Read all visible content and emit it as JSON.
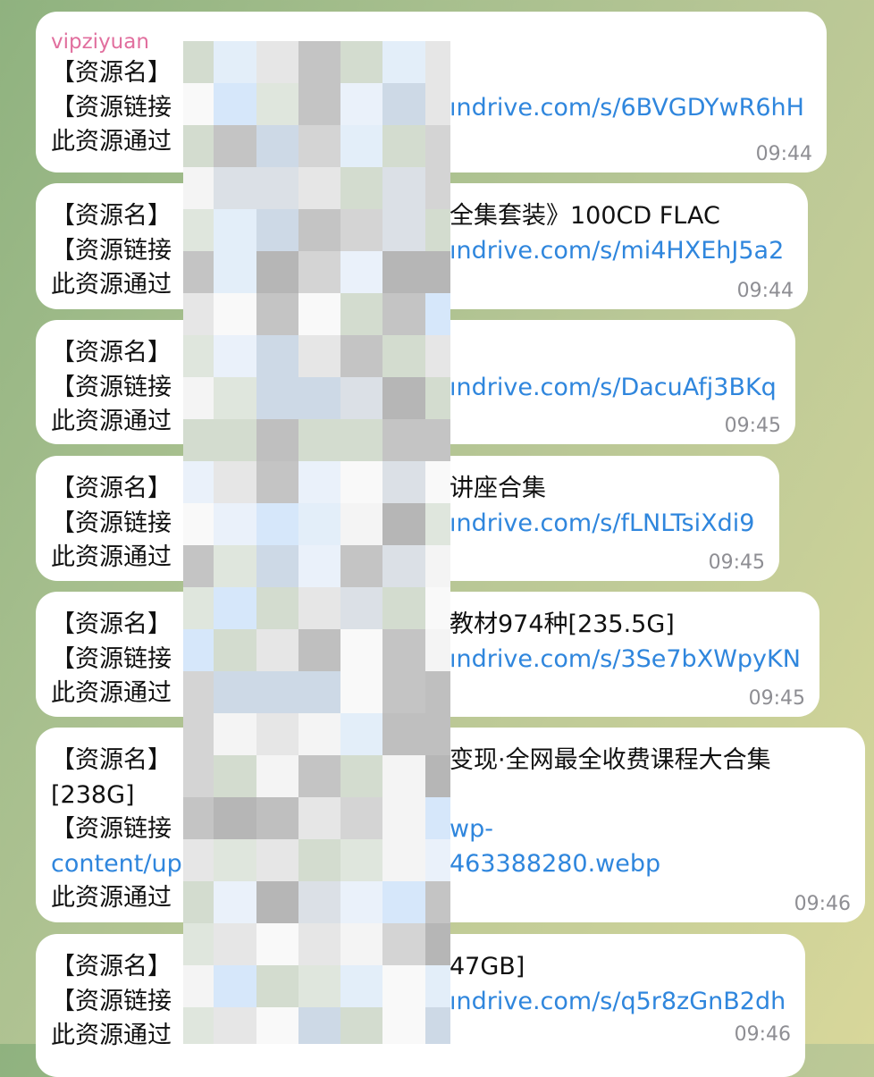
{
  "messages": [
    {
      "sender": "vipziyuan",
      "line1_prefix": "【资源名】",
      "line1_tail": "",
      "line2_prefix": "【资源链接",
      "line2_link": "ındrive.com/s/6BVGDYwR6hH",
      "line3_prefix": "此资源通过",
      "time": "09:44"
    },
    {
      "line1_prefix": "【资源名】",
      "line1_tail": "全集套装》100CD FLAC",
      "line2_prefix": "【资源链接",
      "line2_link": "ındrive.com/s/mi4HXEhJ5a2",
      "line3_prefix": "此资源通过",
      "time": "09:44"
    },
    {
      "line1_prefix": "【资源名】",
      "line1_tail": "",
      "line2_prefix": "【资源链接",
      "line2_link": "ındrive.com/s/DacuAfj3BKq",
      "line3_prefix": "此资源通过",
      "time": "09:45"
    },
    {
      "line1_prefix": "【资源名】",
      "line1_tail": "讲座合集",
      "line2_prefix": "【资源链接",
      "line2_link": "ındrive.com/s/fLNLTsiXdi9",
      "line3_prefix": "此资源通过",
      "time": "09:45"
    },
    {
      "line1_prefix": "【资源名】",
      "line1_tail": "教材974种[235.5G]",
      "line2_prefix": "【资源链接",
      "line2_link": "ındrive.com/s/3Se7bXWpyKN",
      "line3_prefix": "此资源通过",
      "time": "09:45"
    },
    {
      "line1_prefix": "【资源名】",
      "line1_tail": "变现·全网最全收费课程大合集",
      "line1b": "[238G]",
      "line2_prefix": "【资源链接",
      "line2_link": "wp-",
      "line2b_prefix": "content/up",
      "line2b_link": "463388280.webp",
      "line3_prefix": "此资源通过",
      "time": "09:46"
    },
    {
      "line1_prefix": "【资源名】",
      "line1_tail": "47GB]",
      "line2_prefix": "【资源链接",
      "line2_link": "ındrive.com/s/q5r8zGnB2dh",
      "line3_prefix": "此资源通过",
      "time": "09:46"
    }
  ],
  "colors": {
    "sender": "#e16f9e",
    "link": "#2f86dd",
    "time": "#8e8e93",
    "bubble": "#ffffff"
  }
}
